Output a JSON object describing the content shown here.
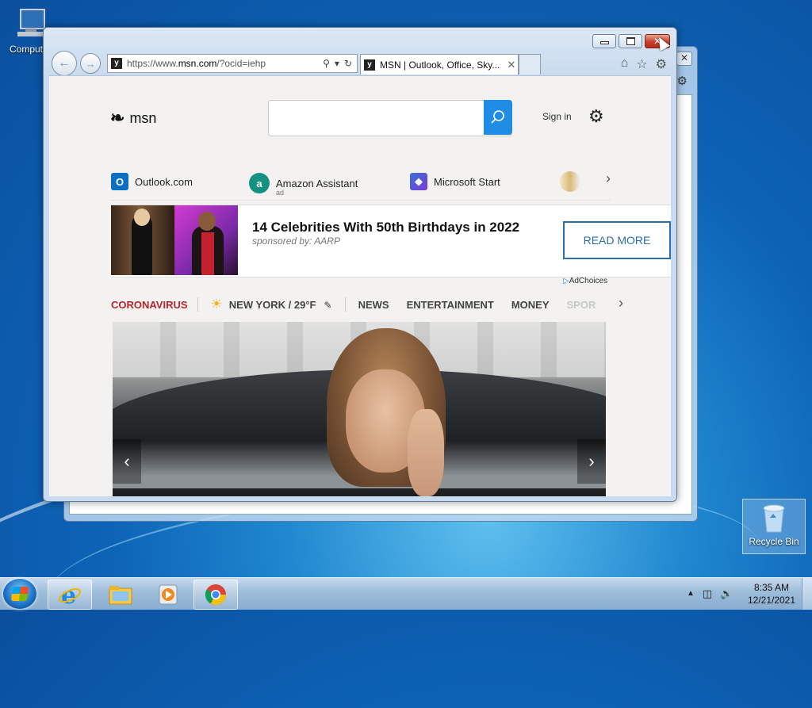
{
  "desktop": {
    "icons": [
      {
        "label": "Computer"
      },
      {
        "label": "Recycle Bin"
      }
    ]
  },
  "browser": {
    "address": {
      "prefix": "https://www.",
      "domain": "msn.com",
      "path": "/?ocid=iehp"
    },
    "tab_title": "MSN | Outlook, Office, Sky...",
    "favicon_letter": "y"
  },
  "msn": {
    "logo_text": "msn",
    "search_placeholder": "",
    "signin_label": "Sign in",
    "quick_links": [
      {
        "label": "Outlook.com",
        "sub": ""
      },
      {
        "label": "Amazon Assistant",
        "sub": "ad"
      },
      {
        "label": "Microsoft Start",
        "sub": ""
      }
    ],
    "ad": {
      "headline": "14 Celebrities With 50th Birthdays in 2022",
      "sponsor": "sponsored by: AARP",
      "cta": "READ MORE",
      "adchoices": "AdChoices"
    },
    "nav": {
      "coronavirus": "CORONAVIRUS",
      "weather": "NEW YORK / 29°F",
      "items": [
        "NEWS",
        "ENTERTAINMENT",
        "MONEY"
      ],
      "faded_item": "SPOR"
    }
  },
  "taskbar": {
    "time": "8:35 AM",
    "date": "12/21/2021"
  },
  "colors": {
    "close_button": "#c7402b",
    "search_button": "#1f8de6",
    "coronavirus": "#b3262c",
    "cta_border": "#2b6fa8"
  }
}
